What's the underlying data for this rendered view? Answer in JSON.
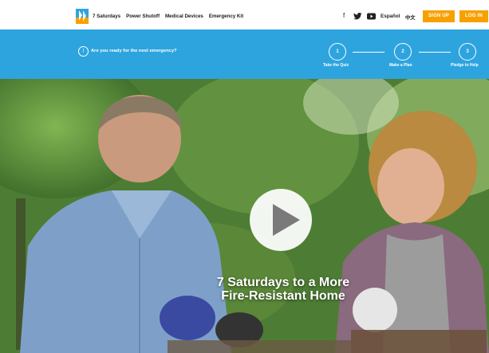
{
  "header": {
    "nav": [
      "7 Saturdays",
      "Power Shutoff",
      "Medical Devices",
      "Emergency Kit"
    ],
    "social_icons": [
      "facebook-icon",
      "twitter-icon",
      "youtube-icon"
    ],
    "languages": [
      "Español",
      "中文"
    ],
    "signup_label": "SIGN UP",
    "login_label": "LOG IN"
  },
  "banner": {
    "question": "Are you ready for the next emergency?",
    "steps": [
      {
        "number": "1",
        "label": "Take the Quiz"
      },
      {
        "number": "2",
        "label": "Make a Plan"
      },
      {
        "number": "3",
        "label": "Pledge to Help"
      }
    ]
  },
  "video": {
    "title_line1": "7 Saturdays to a More",
    "title_line2": "Fire-Resistant Home"
  },
  "colors": {
    "accent_blue": "#2ea4df",
    "button_orange": "#f7a100"
  }
}
